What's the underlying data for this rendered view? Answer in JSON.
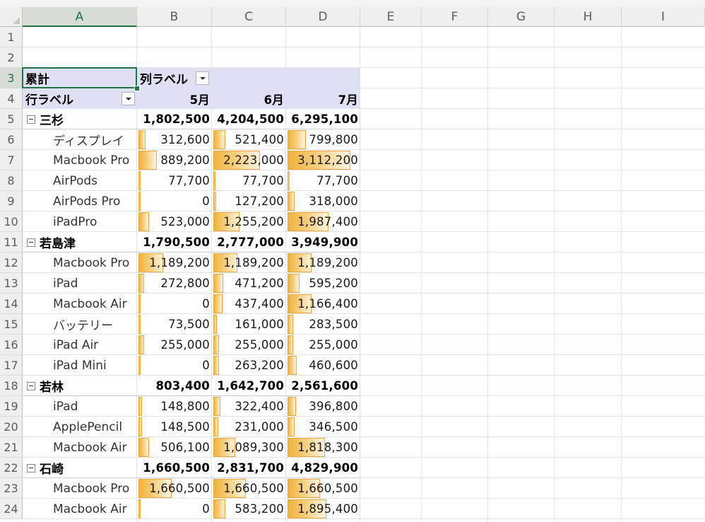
{
  "columns": [
    "A",
    "B",
    "C",
    "D",
    "E",
    "F",
    "G",
    "H",
    "I"
  ],
  "rows": [
    "1",
    "2",
    "3",
    "4",
    "5",
    "6",
    "7",
    "8",
    "9",
    "10",
    "11",
    "12",
    "13",
    "14",
    "15",
    "16",
    "17",
    "18",
    "19",
    "20",
    "21",
    "22",
    "23",
    "24"
  ],
  "pivot": {
    "value_field": "累計",
    "column_labels": "列ラベル",
    "row_labels": "行ラベル",
    "months": [
      "5月",
      "6月",
      "7月"
    ],
    "groups": [
      {
        "name": "三杉",
        "totals": [
          "1,802,500",
          "4,204,500",
          "6,295,100"
        ],
        "items": [
          {
            "name": "ディスプレイ",
            "values": [
              "312,600",
              "521,400",
              "799,800"
            ],
            "bar_fraction": [
              0.1,
              0.17,
              0.26
            ]
          },
          {
            "name": "Macbook Pro",
            "values": [
              "889,200",
              "2,223,000",
              "3,112,200"
            ],
            "bar_fraction": [
              0.25,
              0.65,
              0.88
            ]
          },
          {
            "name": "AirPods",
            "values": [
              "77,700",
              "77,700",
              "77,700"
            ],
            "bar_fraction": [
              0.03,
              0.03,
              0.03
            ]
          },
          {
            "name": "AirPods Pro",
            "values": [
              "0",
              "127,200",
              "318,000"
            ],
            "bar_fraction": [
              0.0,
              0.04,
              0.1
            ]
          },
          {
            "name": "iPadPro",
            "values": [
              "523,000",
              "1,255,200",
              "1,987,400"
            ],
            "bar_fraction": [
              0.15,
              0.37,
              0.57
            ]
          }
        ]
      },
      {
        "name": "若島津",
        "totals": [
          "1,790,500",
          "2,777,000",
          "3,949,900"
        ],
        "items": [
          {
            "name": "Macbook Pro",
            "values": [
              "1,189,200",
              "1,189,200",
              "1,189,200"
            ],
            "bar_fraction": [
              0.34,
              0.34,
              0.34
            ]
          },
          {
            "name": "iPad",
            "values": [
              "272,800",
              "471,200",
              "595,200"
            ],
            "bar_fraction": [
              0.08,
              0.14,
              0.17
            ]
          },
          {
            "name": "Macbook Air",
            "values": [
              "0",
              "437,400",
              "1,166,400"
            ],
            "bar_fraction": [
              0.0,
              0.13,
              0.34
            ]
          },
          {
            "name": "バッテリー",
            "values": [
              "73,500",
              "161,000",
              "283,500"
            ],
            "bar_fraction": [
              0.03,
              0.05,
              0.08
            ]
          },
          {
            "name": "iPad Air",
            "values": [
              "255,000",
              "255,000",
              "255,000"
            ],
            "bar_fraction": [
              0.08,
              0.08,
              0.08
            ]
          },
          {
            "name": "iPad Mini",
            "values": [
              "0",
              "263,200",
              "460,600"
            ],
            "bar_fraction": [
              0.0,
              0.08,
              0.13
            ]
          }
        ]
      },
      {
        "name": "若林",
        "totals": [
          "803,400",
          "1,642,700",
          "2,561,600"
        ],
        "items": [
          {
            "name": "iPad",
            "values": [
              "148,800",
              "322,400",
              "396,800"
            ],
            "bar_fraction": [
              0.05,
              0.1,
              0.12
            ]
          },
          {
            "name": "ApplePencil",
            "values": [
              "148,500",
              "231,000",
              "346,500"
            ],
            "bar_fraction": [
              0.05,
              0.07,
              0.1
            ]
          },
          {
            "name": "Macbook Air",
            "values": [
              "506,100",
              "1,089,300",
              "1,818,300"
            ],
            "bar_fraction": [
              0.15,
              0.31,
              0.52
            ]
          }
        ]
      },
      {
        "name": "石崎",
        "totals": [
          "1,660,500",
          "2,831,700",
          "4,829,900"
        ],
        "items": [
          {
            "name": "Macbook Pro",
            "values": [
              "1,660,500",
              "1,660,500",
              "1,660,500"
            ],
            "bar_fraction": [
              0.46,
              0.46,
              0.46
            ]
          },
          {
            "name": "Macbook Air",
            "values": [
              "0",
              "583,200",
              "1,895,400"
            ],
            "bar_fraction": [
              0.0,
              0.17,
              0.54
            ]
          }
        ]
      }
    ]
  },
  "colors": {
    "header_band": "#dde1f3",
    "selection": "#217346",
    "databar": "#f2b23c"
  },
  "icons": {
    "collapse": "minus-box-icon",
    "filter": "dropdown-arrow-icon"
  }
}
